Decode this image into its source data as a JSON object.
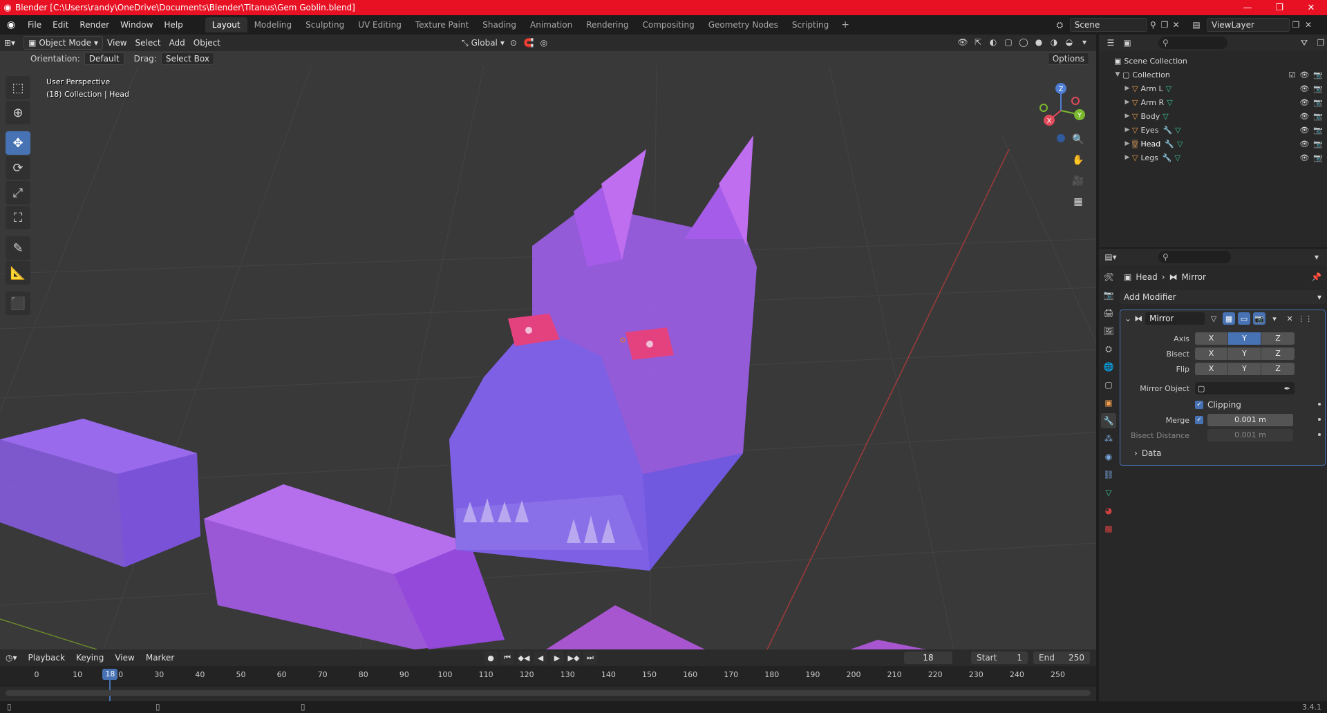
{
  "titlebar": {
    "title": "Blender [C:\\Users\\randy\\OneDrive\\Documents\\Blender\\Titanus\\Gem Goblin.blend]",
    "minimize": "—",
    "maximize": "❐",
    "close": "✕"
  },
  "menubar": {
    "menus": [
      "File",
      "Edit",
      "Render",
      "Window",
      "Help"
    ],
    "workspaces": [
      "Layout",
      "Modeling",
      "Sculpting",
      "UV Editing",
      "Texture Paint",
      "Shading",
      "Animation",
      "Rendering",
      "Compositing",
      "Geometry Nodes",
      "Scripting"
    ],
    "active_workspace": "Layout",
    "scene": "Scene",
    "view_layer": "ViewLayer"
  },
  "viewport": {
    "mode": "Object Mode",
    "menus": [
      "View",
      "Select",
      "Add",
      "Object"
    ],
    "transform_orientation": "Global",
    "orientation_label": "Orientation:",
    "orientation_value": "Default",
    "drag_label": "Drag:",
    "drag_value": "Select Box",
    "options": "Options",
    "info_line1": "User Perspective",
    "info_line2": "(18) Collection | Head",
    "gizmo": {
      "x": "X",
      "y": "Y",
      "z": "Z"
    },
    "colors": {
      "mesh": "#a45ee0",
      "mesh_blue": "#6a5ee0",
      "eye": "#e4417f"
    }
  },
  "toolbar": {
    "tools": [
      "select-box-icon",
      "cursor-icon",
      "move-icon",
      "rotate-icon",
      "scale-icon",
      "transform-icon",
      "annotate-icon",
      "measure-icon",
      "add-cube-icon"
    ],
    "active": "move-icon"
  },
  "timeline": {
    "menus": [
      "Playback",
      "Keying",
      "View",
      "Marker"
    ],
    "current_frame": "18",
    "start_label": "Start",
    "start": "1",
    "end_label": "End",
    "end": "250",
    "ticks": [
      "0",
      "10",
      "20",
      "30",
      "40",
      "50",
      "60",
      "70",
      "80",
      "90",
      "100",
      "110",
      "120",
      "130",
      "140",
      "150",
      "160",
      "170",
      "180",
      "190",
      "200",
      "210",
      "220",
      "230",
      "240",
      "250"
    ]
  },
  "outliner": {
    "scene_collection": "Scene Collection",
    "collection": "Collection",
    "objects": [
      {
        "name": "Arm L",
        "modifier": false
      },
      {
        "name": "Arm R",
        "modifier": false
      },
      {
        "name": "Body",
        "modifier": false
      },
      {
        "name": "Eyes",
        "modifier": true
      },
      {
        "name": "Head",
        "modifier": true
      },
      {
        "name": "Legs",
        "modifier": true
      }
    ]
  },
  "properties": {
    "breadcrumb_object": "Head",
    "breadcrumb_modifier": "Mirror",
    "add_modifier": "Add Modifier",
    "modifier_name": "Mirror",
    "axis_label": "Axis",
    "bisect_label": "Bisect",
    "flip_label": "Flip",
    "axes": [
      "X",
      "Y",
      "Z"
    ],
    "axis_active": "Y",
    "mirror_object_label": "Mirror Object",
    "clipping_label": "Clipping",
    "merge_label": "Merge",
    "merge_value": "0.001 m",
    "bisect_distance_label": "Bisect Distance",
    "bisect_distance_value": "0.001 m",
    "data_label": "Data"
  },
  "statusbar": {
    "version": "3.4.1"
  }
}
